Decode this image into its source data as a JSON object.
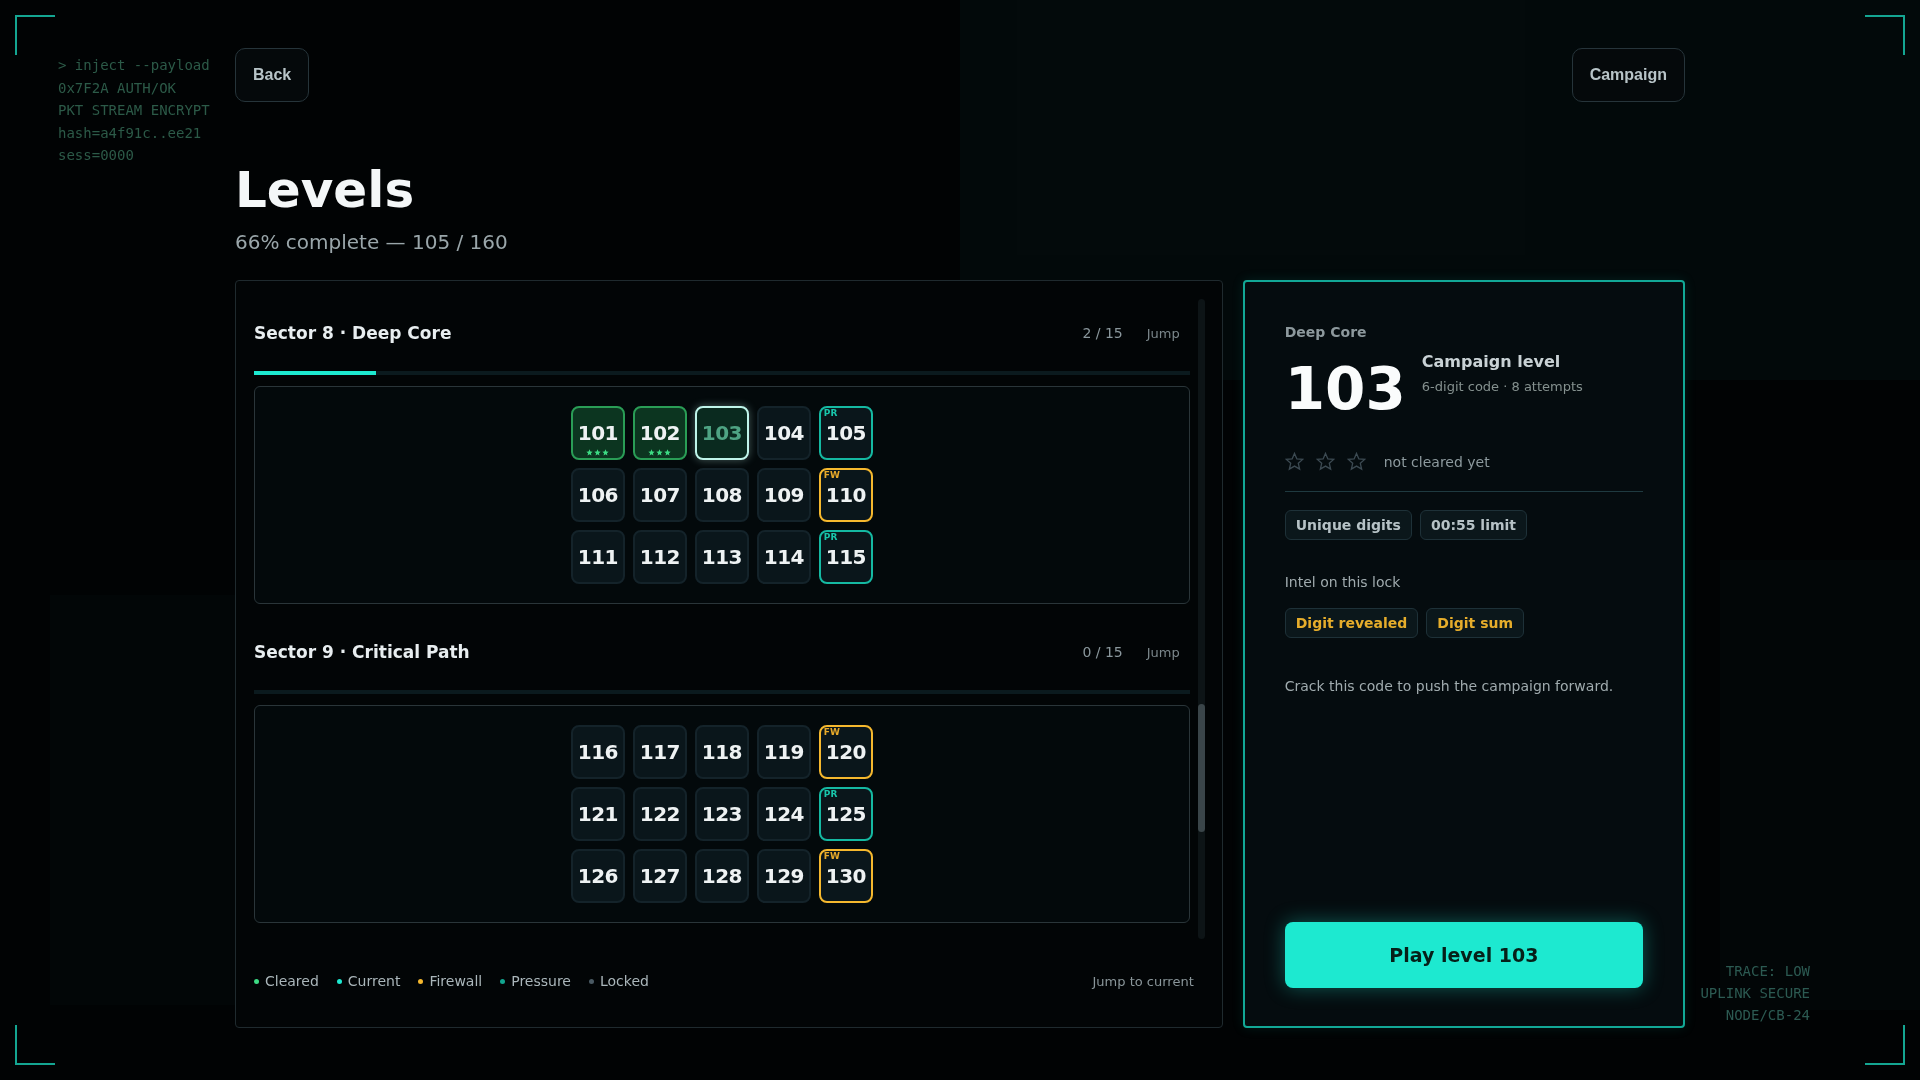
{
  "terminal_lines": [
    "> inject --payload",
    "0x7F2A AUTH/OK",
    "PKT STREAM ENCRYPT",
    "hash=a4f91c..ee21",
    "sess=0000"
  ],
  "status_lines": [
    "TRACE: LOW",
    "UPLINK SECURE",
    "NODE/CB-24"
  ],
  "back_button": "Back",
  "campaign_button": "Campaign",
  "title": "Levels",
  "subtitle": "66% complete — 105 / 160",
  "sectors": [
    {
      "title": "Sector 8 · Deep Core",
      "count": "2 / 15",
      "jump": "Jump",
      "level": 0.13,
      "levels": [
        {
          "number": "101",
          "kind": "cleared",
          "stars": 3
        },
        {
          "number": "102",
          "kind": "cleared",
          "stars": 3
        },
        {
          "number": "103",
          "kind": "current",
          "selected": true
        },
        {
          "number": "104",
          "kind": "open"
        },
        {
          "number": "105",
          "kind": "pressure",
          "tag": "PR"
        },
        {
          "number": "106",
          "kind": "open"
        },
        {
          "number": "107",
          "kind": "open"
        },
        {
          "number": "108",
          "kind": "open"
        },
        {
          "number": "109",
          "kind": "open"
        },
        {
          "number": "110",
          "kind": "firewall",
          "tag": "FW"
        },
        {
          "number": "111",
          "kind": "open"
        },
        {
          "number": "112",
          "kind": "open"
        },
        {
          "number": "113",
          "kind": "open"
        },
        {
          "number": "114",
          "kind": "open"
        },
        {
          "number": "115",
          "kind": "pressure",
          "tag": "PR"
        }
      ]
    },
    {
      "title": "Sector 9 · Critical Path",
      "count": "0 / 15",
      "jump": "Jump",
      "level": 0,
      "levels": [
        {
          "number": "116",
          "kind": "open"
        },
        {
          "number": "117",
          "kind": "open"
        },
        {
          "number": "118",
          "kind": "open"
        },
        {
          "number": "119",
          "kind": "open"
        },
        {
          "number": "120",
          "kind": "firewall",
          "tag": "FW"
        },
        {
          "number": "121",
          "kind": "open"
        },
        {
          "number": "122",
          "kind": "open"
        },
        {
          "number": "123",
          "kind": "open"
        },
        {
          "number": "124",
          "kind": "open"
        },
        {
          "number": "125",
          "kind": "pressure",
          "tag": "PR"
        },
        {
          "number": "126",
          "kind": "open"
        },
        {
          "number": "127",
          "kind": "open"
        },
        {
          "number": "128",
          "kind": "open"
        },
        {
          "number": "129",
          "kind": "open"
        },
        {
          "number": "130",
          "kind": "firewall",
          "tag": "FW"
        }
      ]
    }
  ],
  "legend": [
    {
      "label": "Cleared",
      "color": "#3ddc84"
    },
    {
      "label": "Current",
      "color": "#1de9d0"
    },
    {
      "label": "Firewall",
      "color": "#f5b82e"
    },
    {
      "label": "Pressure",
      "color": "#12a58f"
    },
    {
      "label": "Locked",
      "color": "#4a5a63"
    }
  ],
  "jump_to_current": "Jump to current",
  "detail": {
    "sector": "Deep Core",
    "number": "103",
    "type": "Campaign level",
    "meta": "6-digit code · 8 attempts",
    "stars": 0,
    "stars_note": "not cleared yet",
    "rules": [
      "Unique digits",
      "00:55 limit"
    ],
    "intel_label": "Intel on this lock",
    "intel": [
      "Digit revealed",
      "Digit sum"
    ],
    "description": "Crack this code to push the campaign forward.",
    "play_button": "Play level 103"
  }
}
